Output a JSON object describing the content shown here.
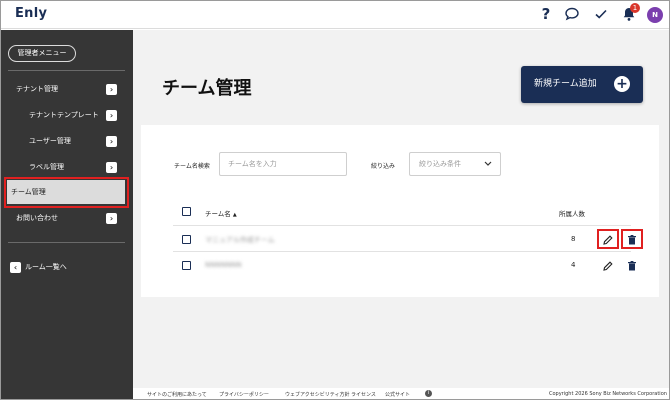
{
  "header": {
    "logo": "Enly",
    "help_icon": "question-icon",
    "chat_icon": "chat-icon",
    "check_icon": "check-icon",
    "bell_icon": "bell-icon",
    "notification_count": "1",
    "avatar_initial": "N"
  },
  "sidebar": {
    "admin_menu_label": "管理者メニュー",
    "items": [
      {
        "label": "テナント管理"
      },
      {
        "label": "テナントテンプレート"
      },
      {
        "label": "ユーザー管理"
      },
      {
        "label": "ラベル管理"
      },
      {
        "label": "チーム管理"
      },
      {
        "label": "お問い合わせ"
      }
    ],
    "room_list_label": "ルーム一覧へ"
  },
  "main": {
    "title": "チーム管理",
    "new_team_button": "新規チーム追加",
    "search": {
      "label": "チーム名検索",
      "placeholder": "チーム名を入力"
    },
    "filter": {
      "label": "絞り込み",
      "placeholder": "絞り込み条件"
    },
    "table": {
      "col_name": "チーム名",
      "sort_indicator": "▲",
      "col_members": "所属人数",
      "rows": [
        {
          "name": "マニュアル作成チーム",
          "members": "8"
        },
        {
          "name": "NNNNNNN",
          "members": "4"
        }
      ]
    }
  },
  "footer": {
    "links": [
      "サイトのご利用にあたって",
      "プライバシーポリシー",
      "ウェブアクセシビリティ方針",
      "ライセンス",
      "公式サイト"
    ],
    "copyright": "Copyright 2026 Sony Biz Networks Corporation"
  },
  "colors": {
    "brand_navy": "#1a2e55",
    "sidebar_bg": "#363636",
    "highlight_red": "#e02020",
    "badge_red": "#d9362b",
    "avatar_purple": "#7b3fae"
  }
}
